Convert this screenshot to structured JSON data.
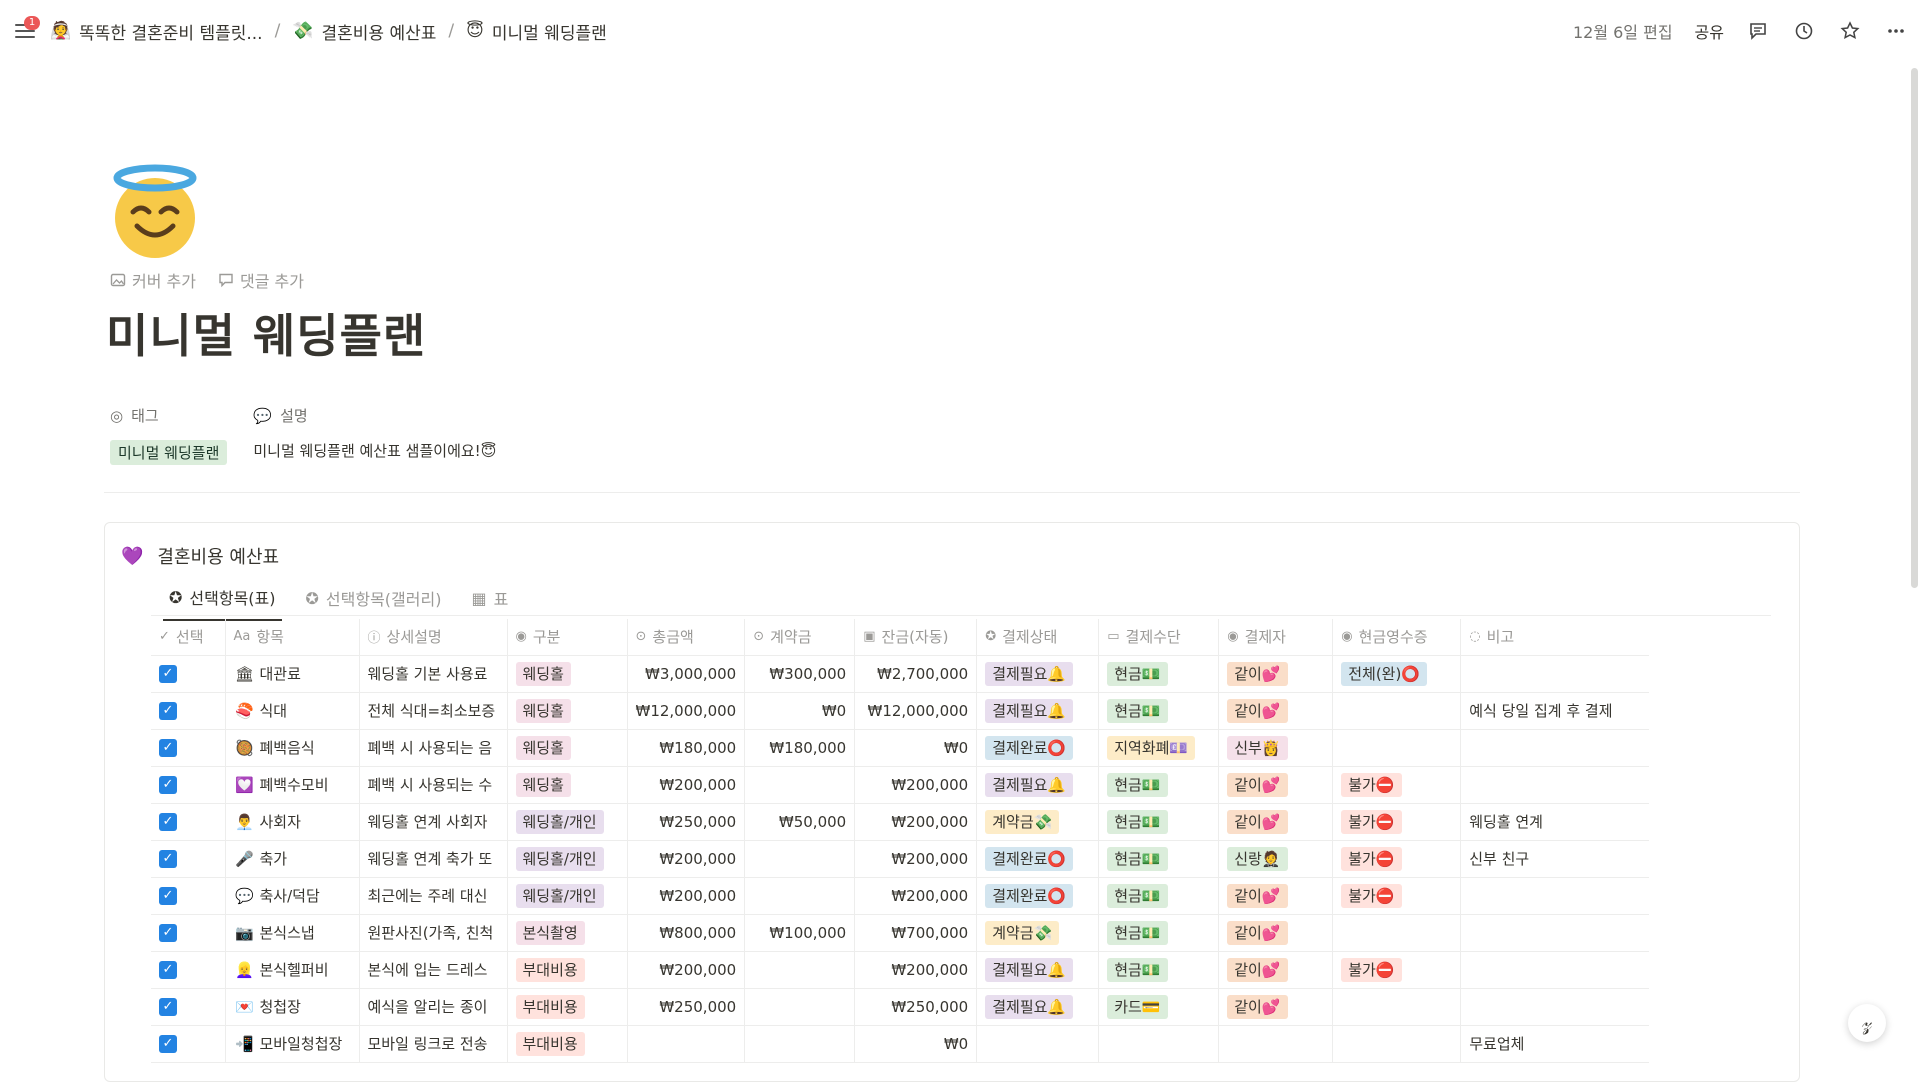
{
  "topbar": {
    "notification_count": "1",
    "breadcrumbs": [
      {
        "icon": "👰",
        "label": "똑똑한 결혼준비 템플릿..."
      },
      {
        "icon": "💸",
        "label": "결혼비용 예산표"
      },
      {
        "icon": "😇",
        "label": "미니멀 웨딩플랜"
      }
    ],
    "edited": "12월 6일 편집",
    "share": "공유"
  },
  "page": {
    "icon": "smiling-angel-icon",
    "add_cover": "커버 추가",
    "add_comment": "댓글 추가",
    "title": "미니멀 웨딩플랜",
    "props": {
      "tag_label": "태그",
      "tag_value": "미니멀 웨딩플랜",
      "desc_label": "설명",
      "desc_value": "미니멀 웨딩플랜 예산표 샘플이에요!😇"
    }
  },
  "database": {
    "icon": "💜",
    "title": "결혼비용 예산표",
    "tabs": [
      {
        "icon": "✪",
        "label": "선택항목(표)"
      },
      {
        "icon": "✪",
        "label": "선택항목(갤러리)"
      },
      {
        "icon": "▦",
        "label": "표"
      }
    ],
    "columns": [
      {
        "icon": "✓",
        "label": "선택"
      },
      {
        "icon": "Aa",
        "label": "항목"
      },
      {
        "icon": "ⓘ",
        "label": "상세설명"
      },
      {
        "icon": "◉",
        "label": "구분"
      },
      {
        "icon": "⊙",
        "label": "총금액"
      },
      {
        "icon": "⊙",
        "label": "계약금"
      },
      {
        "icon": "▣",
        "label": "잔금(자동)"
      },
      {
        "icon": "✪",
        "label": "결제상태"
      },
      {
        "icon": "▭",
        "label": "결제수단"
      },
      {
        "icon": "◉",
        "label": "결제자"
      },
      {
        "icon": "◉",
        "label": "현금영수증"
      },
      {
        "icon": "◌",
        "label": "비고"
      }
    ],
    "rows": [
      {
        "icon": "🏛",
        "item": "대관료",
        "desc": "웨딩홀 기본 사용료",
        "cat": "웨딩홀",
        "total": "₩3,000,000",
        "deposit": "₩300,000",
        "balance": "₩2,700,000",
        "status": "결제필요🔔",
        "method": "현금💵",
        "payer": "같이💕",
        "receipt": "전체(완)⭕",
        "note": ""
      },
      {
        "icon": "🍣",
        "item": "식대",
        "desc": "전체 식대=최소보증",
        "cat": "웨딩홀",
        "total": "₩12,000,000",
        "deposit": "₩0",
        "balance": "₩12,000,000",
        "status": "결제필요🔔",
        "method": "현금💵",
        "payer": "같이💕",
        "receipt": "",
        "note": "예식 당일 집계 후 결제"
      },
      {
        "icon": "🥘",
        "item": "폐백음식",
        "desc": "폐백 시 사용되는 음",
        "cat": "웨딩홀",
        "total": "₩180,000",
        "deposit": "₩180,000",
        "balance": "₩0",
        "status": "결제완료⭕",
        "method": "지역화폐💷",
        "payer": "신부👸",
        "receipt": "",
        "note": ""
      },
      {
        "icon": "💟",
        "item": "폐백수모비",
        "desc": "폐백 시 사용되는 수",
        "cat": "웨딩홀",
        "total": "₩200,000",
        "deposit": "",
        "balance": "₩200,000",
        "status": "결제필요🔔",
        "method": "현금💵",
        "payer": "같이💕",
        "receipt": "불가⛔",
        "note": ""
      },
      {
        "icon": "👨‍💼",
        "item": "사회자",
        "desc": "웨딩홀 연계 사회자",
        "cat": "웨딩홀/개인",
        "total": "₩250,000",
        "deposit": "₩50,000",
        "balance": "₩200,000",
        "status": "계약금💸",
        "method": "현금💵",
        "payer": "같이💕",
        "receipt": "불가⛔",
        "note": "웨딩홀 연계"
      },
      {
        "icon": "🎤",
        "item": "축가",
        "desc": "웨딩홀 연계 축가 또",
        "cat": "웨딩홀/개인",
        "total": "₩200,000",
        "deposit": "",
        "balance": "₩200,000",
        "status": "결제완료⭕",
        "method": "현금💵",
        "payer": "신랑🤵",
        "receipt": "불가⛔",
        "note": "신부 친구"
      },
      {
        "icon": "💬",
        "item": "축사/덕담",
        "desc": "최근에는 주례 대신",
        "cat": "웨딩홀/개인",
        "total": "₩200,000",
        "deposit": "",
        "balance": "₩200,000",
        "status": "결제완료⭕",
        "method": "현금💵",
        "payer": "같이💕",
        "receipt": "불가⛔",
        "note": ""
      },
      {
        "icon": "📷",
        "item": "본식스냅",
        "desc": "원판사진(가족, 친척",
        "cat": "본식촬영",
        "total": "₩800,000",
        "deposit": "₩100,000",
        "balance": "₩700,000",
        "status": "계약금💸",
        "method": "현금💵",
        "payer": "같이💕",
        "receipt": "",
        "note": ""
      },
      {
        "icon": "👱‍♀️",
        "item": "본식헬퍼비",
        "desc": "본식에 입는 드레스",
        "cat": "부대비용",
        "total": "₩200,000",
        "deposit": "",
        "balance": "₩200,000",
        "status": "결제필요🔔",
        "method": "현금💵",
        "payer": "같이💕",
        "receipt": "불가⛔",
        "note": ""
      },
      {
        "icon": "💌",
        "item": "청첩장",
        "desc": "예식을 알리는 종이",
        "cat": "부대비용",
        "total": "₩250,000",
        "deposit": "",
        "balance": "₩250,000",
        "status": "결제필요🔔",
        "method": "카드💳",
        "payer": "같이💕",
        "receipt": "",
        "note": ""
      },
      {
        "icon": "📲",
        "item": "모바일청첩장",
        "desc": "모바일 링크로 전송",
        "cat": "부대비용",
        "total": "",
        "deposit": "",
        "balance": "₩0",
        "status": "",
        "method": "",
        "payer": "",
        "receipt": "",
        "note": "무료업체"
      }
    ]
  },
  "colors": {
    "checkbox": "#2383e2",
    "tag_green": "#dbeddb",
    "cat_웨딩홀": "#f5e0e9",
    "cat_웨딩홀/개인": "#e8deee",
    "cat_본식촬영": "#f5e0e9",
    "cat_부대비용": "#ffe2dd"
  }
}
